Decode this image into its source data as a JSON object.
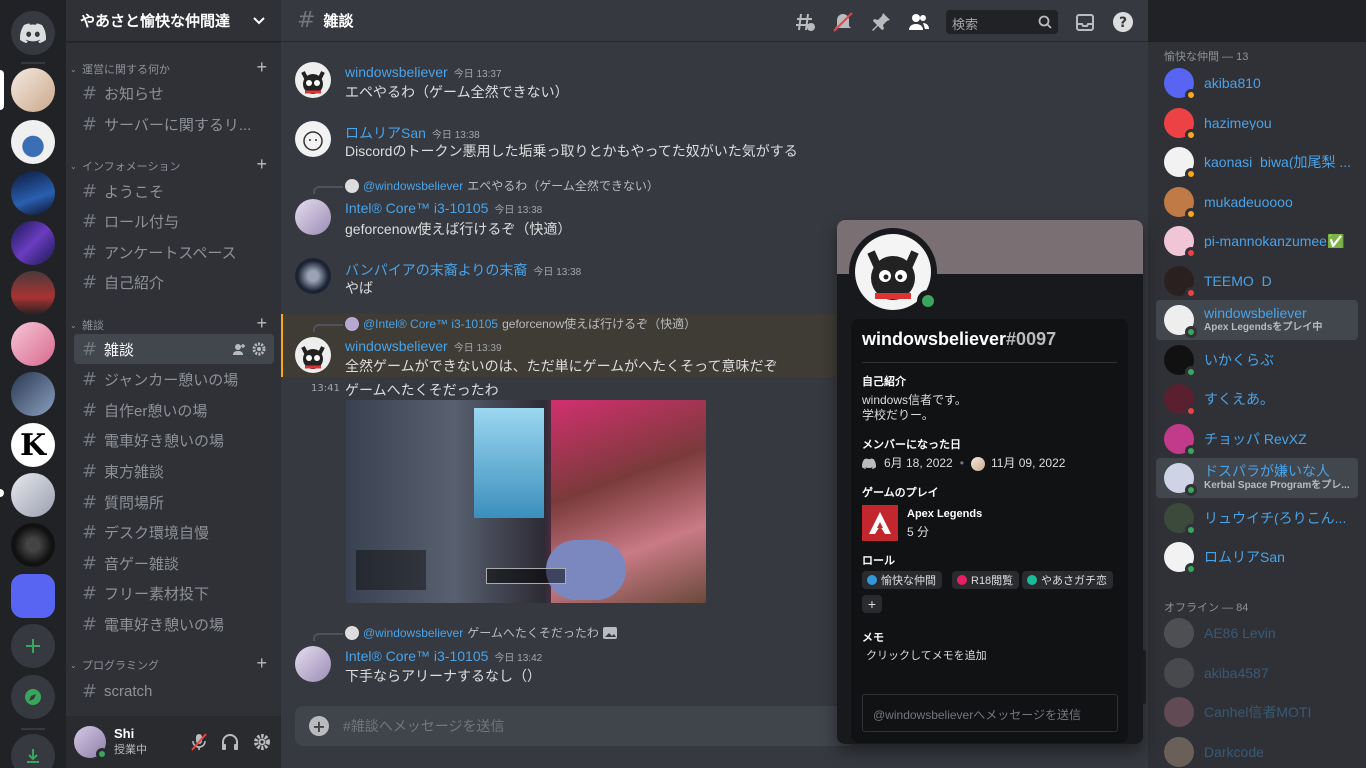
{
  "guild": {
    "name": "やあさと愉快な仲間達"
  },
  "categories": [
    {
      "label": "運営に関する何か"
    },
    {
      "label": "インフォメーション"
    },
    {
      "label": "雑談"
    },
    {
      "label": "プログラミング"
    }
  ],
  "channels": [
    {
      "label": "お知らせ"
    },
    {
      "label": "サーバーに関するリ..."
    },
    {
      "label": "ようこそ"
    },
    {
      "label": "ロール付与"
    },
    {
      "label": "アンケートスペース"
    },
    {
      "label": "自己紹介"
    },
    {
      "label": "雑談"
    },
    {
      "label": "ジャンカー憩いの場"
    },
    {
      "label": "自作er憩いの場"
    },
    {
      "label": "電車好き憩いの場"
    },
    {
      "label": "東方雑談"
    },
    {
      "label": "質問場所"
    },
    {
      "label": "デスク環境自慢"
    },
    {
      "label": "音ゲー雑談"
    },
    {
      "label": "フリー素材投下"
    },
    {
      "label": "電車好き憩いの場"
    },
    {
      "label": "scratch"
    }
  ],
  "user": {
    "name": "Shi",
    "status": "授業中"
  },
  "header": {
    "channel": "雑談",
    "search_placeholder": "検索"
  },
  "messages": [
    {
      "author": "windowsbeliever",
      "time": "今日 13:37",
      "text": "エペやるわ（ゲーム全然できない）"
    },
    {
      "author": "ロムリアSan",
      "time": "今日 13:38",
      "text": "Discordのトークン悪用した垢乗っ取りとかもやってた奴がいた気がする"
    },
    {
      "reply_to": "@windowsbeliever",
      "reply_text": "エペやるわ（ゲーム全然できない）",
      "author": "Intel® Core™ i3-10105",
      "time": "今日 13:38",
      "text": "geforcenow使えば行けるぞ（快適）"
    },
    {
      "author": "バンパイアの末裔よりの末裔",
      "time": "今日 13:38",
      "text": "やば"
    },
    {
      "reply_to": "@Intel® Core™ i3-10105",
      "reply_text": "geforcenow使えば行けるぞ（快適）",
      "author": "windowsbeliever",
      "time": "今日 13:39",
      "text": "全然ゲームができないのは、ただ単にゲームがへたくそって意味だぞ"
    },
    {
      "side_time": "13:41",
      "text": "ゲームへたくそだったわ"
    },
    {
      "reply_to": "@windowsbeliever",
      "reply_text": "ゲームへたくそだったわ",
      "author": "Intel® Core™ i3-10105",
      "time": "今日 13:42",
      "text": "下手ならアリーナするなし（）"
    }
  ],
  "composer": {
    "placeholder": "#雑談へメッセージを送信"
  },
  "members": {
    "online_header": "愉快な仲間 — 13",
    "offline_header": "オフライン — 84",
    "online": [
      {
        "name": "akiba810",
        "status_color": "#faa81a",
        "av": "#5865f2"
      },
      {
        "name": "hazimeyou",
        "status_color": "#faa81a",
        "av": "#ed4245"
      },
      {
        "name": "kaonasi_biwa(加尾梨 ...",
        "status_color": "#faa81a",
        "av": "#f2f2f2"
      },
      {
        "name": "mukadeuoooo",
        "status_color": "#faa81a",
        "av": "#c07a45"
      },
      {
        "name": "pi-mannokanzumee✅",
        "status_color": "#ed4245",
        "av": "#f0c6d6"
      },
      {
        "name": "TEEMO_D",
        "status_color": "#ed4245",
        "av": "#2a2020"
      },
      {
        "name": "windowsbeliever",
        "activity": "Apex Legendsをプレイ中",
        "status_color": "#3ba55d",
        "av": "#eeeeee"
      },
      {
        "name": "いかくらぶ",
        "status_color": "#3ba55d",
        "av": "#111111"
      },
      {
        "name": "すくえあ。",
        "status_color": "#ed4245",
        "av": "#5a2030"
      },
      {
        "name": "チョッパ RevXZ",
        "status_color": "#3ba55d",
        "av": "#c23a8a"
      },
      {
        "name": "ドスパラが嫌いな人",
        "activity": "Kerbal Space Programをプレ...",
        "status_color": "#3ba55d",
        "av": "#cfd3e6"
      },
      {
        "name": "リュウイチ(ろりこん...",
        "status_color": "#3ba55d",
        "av": "#3b4a3a"
      },
      {
        "name": "ロムリアSan",
        "status_color": "#3ba55d",
        "av": "#f2f2f2"
      }
    ],
    "offline": [
      {
        "name": "AE86 Levin",
        "av": "#888888"
      },
      {
        "name": "akiba4587",
        "av": "#777777"
      },
      {
        "name": "Canhel信者MOTI",
        "av": "#c07a8a"
      },
      {
        "name": "Darkcode",
        "av": "#d8b89a"
      }
    ]
  },
  "popout": {
    "username": "windowsbeliever",
    "discriminator": "#0097",
    "about_label": "自己紹介",
    "about_lines": [
      "windows信者です。",
      "学校だりー。"
    ],
    "member_since_label": "メンバーになった日",
    "discord_date": "6月 18, 2022",
    "server_date": "11月 09, 2022",
    "playing_label": "ゲームのプレイ",
    "game": "Apex Legends",
    "game_time": "5 分",
    "roles_label": "ロール",
    "roles": [
      {
        "name": "愉快な仲間",
        "color": "#3498db"
      },
      {
        "name": "R18閲覧",
        "color": "#e91e63"
      },
      {
        "name": "やあさガチ恋",
        "color": "#1abc9c"
      }
    ],
    "note_label": "メモ",
    "note_placeholder": "クリックしてメモを追加",
    "message_placeholder": "@windowsbelieverへメッセージを送信"
  },
  "colors": {
    "accent": "#5865f2",
    "online": "#3ba55d",
    "idle": "#faa81a",
    "dnd": "#ed4245"
  }
}
